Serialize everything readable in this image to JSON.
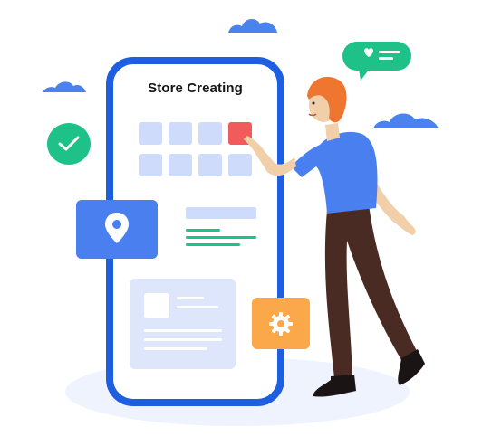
{
  "phone": {
    "title": "Store Creating",
    "grid": {
      "rows": 2,
      "cols": 4,
      "active_tile": 3
    }
  },
  "icons": {
    "location": "location-pin-icon",
    "settings": "gear-icon",
    "check": "checkmark-icon",
    "message": "heart-chat-bubble-icon"
  },
  "colors": {
    "phone_frame": "#1d5fe0",
    "tile": "#cfdbfb",
    "tile_active": "#f25b5b",
    "location_card": "#4a7ff0",
    "settings_card": "#fba84a",
    "check_badge": "#1ec289",
    "chat_bubble": "#1ec289",
    "text_line_green": "#1ec289",
    "cloud": "#4a82ee",
    "shirt": "#4a7ff0",
    "pants": "#4a2b24",
    "hair": "#ef7631"
  }
}
